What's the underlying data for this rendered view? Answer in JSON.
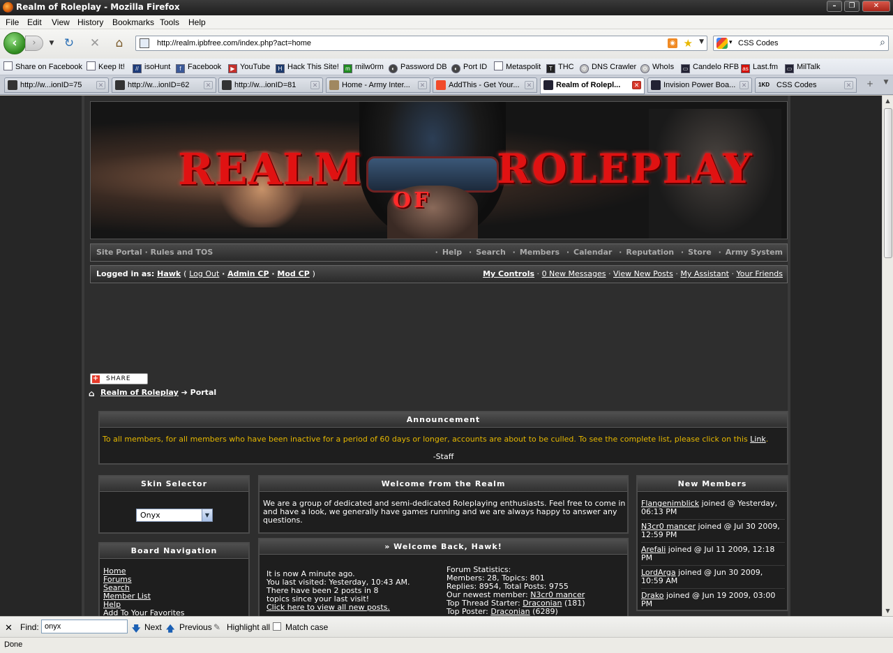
{
  "window": {
    "title": "Realm of Roleplay - Mozilla Firefox",
    "minimize": "–",
    "maximize": "❐",
    "close": "✕"
  },
  "menu": [
    "File",
    "Edit",
    "View",
    "History",
    "Bookmarks",
    "Tools",
    "Help"
  ],
  "nav": {
    "url": "http://realm.ipbfree.com/index.php?act=home",
    "search_engine_value": "CSS Codes"
  },
  "bookmarks": [
    "Share on Facebook",
    "Keep It!",
    "isoHunt",
    "Facebook",
    "YouTube",
    "Hack This Site!",
    "milw0rm",
    "Password DB",
    "Port ID",
    "Metaspolit",
    "THC",
    "DNS Crawler",
    "WhoIs",
    "Candelo RFB",
    "Last.fm",
    "MilTalk"
  ],
  "tabs": [
    {
      "label": "http://w...ionID=75",
      "active": false
    },
    {
      "label": "http://w...ionID=62",
      "active": false
    },
    {
      "label": "http://w...ionID=81",
      "active": false
    },
    {
      "label": "Home - Army Inter...",
      "active": false
    },
    {
      "label": "AddThis - Get Your...",
      "active": false
    },
    {
      "label": "Realm of Rolepl...",
      "active": true
    },
    {
      "label": "Invision Power Boa...",
      "active": false
    },
    {
      "label": "CSS Codes",
      "active": false
    }
  ],
  "banner": {
    "word1": "REALM",
    "word2": "OF",
    "word3": "ROLEPLAY"
  },
  "site_nav": {
    "left": [
      "Site Portal",
      "Rules and TOS"
    ],
    "right": [
      "Help",
      "Search",
      "Members",
      "Calendar",
      "Reputation",
      "Store",
      "Army System"
    ]
  },
  "userbar": {
    "prefix": "Logged in as:",
    "username": "Hawk",
    "logout": "Log Out",
    "admin": "Admin CP",
    "mod": "Mod CP",
    "my_controls": "My Controls",
    "messages": "0 New Messages",
    "new_posts": "View New Posts",
    "assistant": "My Assistant",
    "friends": "Your Friends"
  },
  "share": {
    "label": "SHARE"
  },
  "breadcrumb": {
    "root": "Realm of Roleplay",
    "current": "Portal"
  },
  "announcement": {
    "title": "Announcement",
    "message": "To all members, for all members who have been inactive for a period of 60 days or longer, accounts are about to be culled. To see the complete list, please click on this",
    "link": "Link",
    "signature": "-Staff"
  },
  "skin_selector": {
    "title": "Skin Selector",
    "selected": "Onyx"
  },
  "board_nav": {
    "title": "Board Navigation",
    "links": [
      "Home",
      "Forums",
      "Search",
      "Member List",
      "Help",
      "Add To Your Favorites"
    ]
  },
  "welcome": {
    "title": "Welcome from the Realm",
    "text": "We are a group of dedicated and semi-dedicated Roleplaying enthusiasts. Feel free to come in and have a look, we generally have games running and we are always happy to answer any questions."
  },
  "welcome_back": {
    "title": "» Welcome Back, Hawk!",
    "now": "It is now A minute ago.",
    "last_visit": "You last visited: Yesterday, 10:43 AM.",
    "posts_line1": "There have been 2 posts in 8",
    "posts_line2": "topics since your last visit!",
    "view_link": "Click here to view all new posts.",
    "stats_title": "Forum Statistics:",
    "members": "Members: 28, Topics: 801",
    "replies": "Replies: 8954, Total Posts: 9755",
    "newest_label": "Our newest member:",
    "newest_member": "N3cr0 mancer",
    "top_thread_label": "Top Thread Starter:",
    "top_thread_user": "Draconian",
    "top_thread_count": "(181)",
    "top_poster_label": "Top Poster:",
    "top_poster_user": "Draconian",
    "top_poster_count": "(6289)"
  },
  "new_members": {
    "title": "New Members",
    "items": [
      {
        "name": "Flangenimblick",
        "line1": " joined @ Yesterday,",
        "line2": "06:13 PM"
      },
      {
        "name": "N3cr0 mancer",
        "line1": " joined @ Jul 30 2009,",
        "line2": "12:59 PM"
      },
      {
        "name": "Arefali",
        "line1": " joined @ Jul 11 2009, 12:18",
        "line2": "PM"
      },
      {
        "name": "LordArga",
        "line1": " joined @ Jun 30 2009,",
        "line2": "10:59 AM"
      },
      {
        "name": "Drako",
        "line1": " joined @ Jun 19 2009, 03:00",
        "line2": "PM"
      }
    ]
  },
  "findbar": {
    "label": "Find:",
    "value": "onyx",
    "next": "Next",
    "previous": "Previous",
    "highlight": "Highlight all",
    "match_case": "Match case"
  },
  "status": {
    "text": "Done"
  }
}
